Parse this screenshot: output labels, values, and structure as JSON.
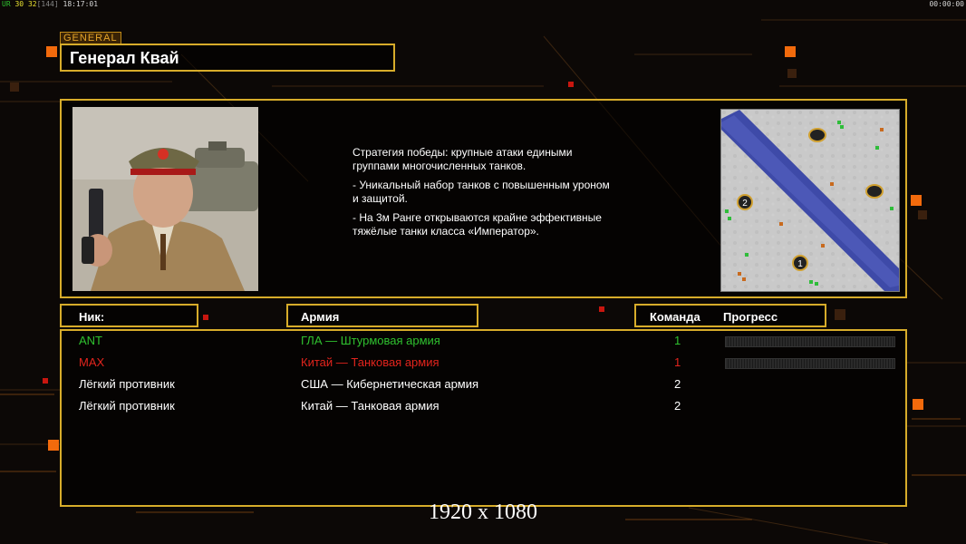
{
  "hud": {
    "fps_label": "UR",
    "fps_a": "30",
    "fps_b": "32",
    "fps_c": "[144]",
    "clock": "18:17:01",
    "timer": "00:00:00"
  },
  "general": {
    "tag": "GENERAL",
    "name": "Генерал Квай",
    "description": [
      "Стратегия победы: крупные атаки едиными\n группами многочисленных танков.",
      "- Уникальный набор танков с повышенным уроном\n и защитой.",
      "- На 3м Ранге открываются крайне эффективные\n тяжёлые танки класса «Император»."
    ]
  },
  "minimap": {
    "spawn_labels": [
      "2",
      "1"
    ]
  },
  "table": {
    "headers": {
      "nick": "Ник:",
      "army": "Армия",
      "team": "Команда",
      "progress": "Прогресс"
    },
    "rows": [
      {
        "nick": "ANT",
        "army": "ГЛА — Штурмовая армия",
        "team": "1",
        "color": "#2fc12f",
        "progress": 0
      },
      {
        "nick": "MAX",
        "army": "Китай — Танковая армия",
        "team": "1",
        "color": "#e2241d",
        "progress": 0
      },
      {
        "nick": "Лёгкий противник",
        "army": "США — Кибернетическая армия",
        "team": "2",
        "color": "#ffffff",
        "progress": null
      },
      {
        "nick": "Лёгкий противник",
        "army": "Китай — Танковая армия",
        "team": "2",
        "color": "#ffffff",
        "progress": null
      }
    ]
  },
  "footer": {
    "resolution": "1920 x 1080"
  },
  "colors": {
    "frame": "#d7ac2a",
    "accent_orange": "#f26a0c"
  }
}
